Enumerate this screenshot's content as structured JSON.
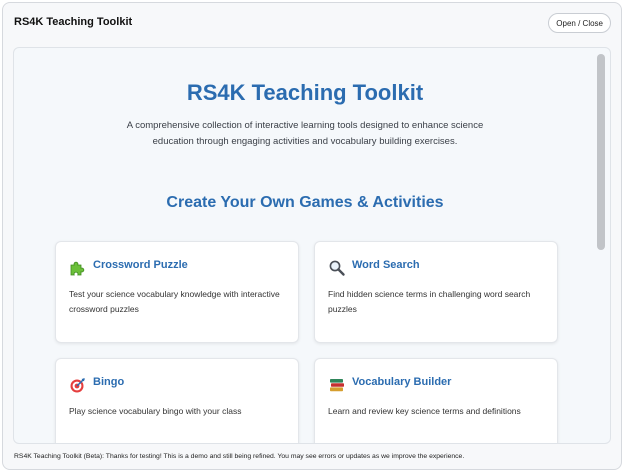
{
  "window": {
    "title": "RS4K Teaching Toolkit",
    "toggle_label": "Open / Close"
  },
  "hero": {
    "title": "RS4K Teaching Toolkit",
    "subtitle": "A comprehensive collection of interactive learning tools designed to enhance science education through engaging activities and vocabulary building exercises."
  },
  "section": {
    "title": "Create Your Own Games & Activities"
  },
  "cards": [
    {
      "title": "Crossword Puzzle",
      "description": "Test your science vocabulary knowledge with interactive crossword puzzles",
      "icon": "puzzle-piece-icon"
    },
    {
      "title": "Word Search",
      "description": "Find hidden science terms in challenging word search puzzles",
      "icon": "magnifying-glass-icon"
    },
    {
      "title": "Bingo",
      "description": "Play science vocabulary bingo with your class",
      "icon": "target-dart-icon"
    },
    {
      "title": "Vocabulary Builder",
      "description": "Learn and review key science terms and definitions",
      "icon": "books-icon"
    }
  ],
  "footer": {
    "text": "RS4K Teaching Toolkit (Beta): Thanks for testing! This is a demo and still being refined. You may see errors or updates as we improve the experience."
  },
  "colors": {
    "accent": "#2b6cb0",
    "background": "#f5f8fb",
    "card": "#ffffff"
  }
}
